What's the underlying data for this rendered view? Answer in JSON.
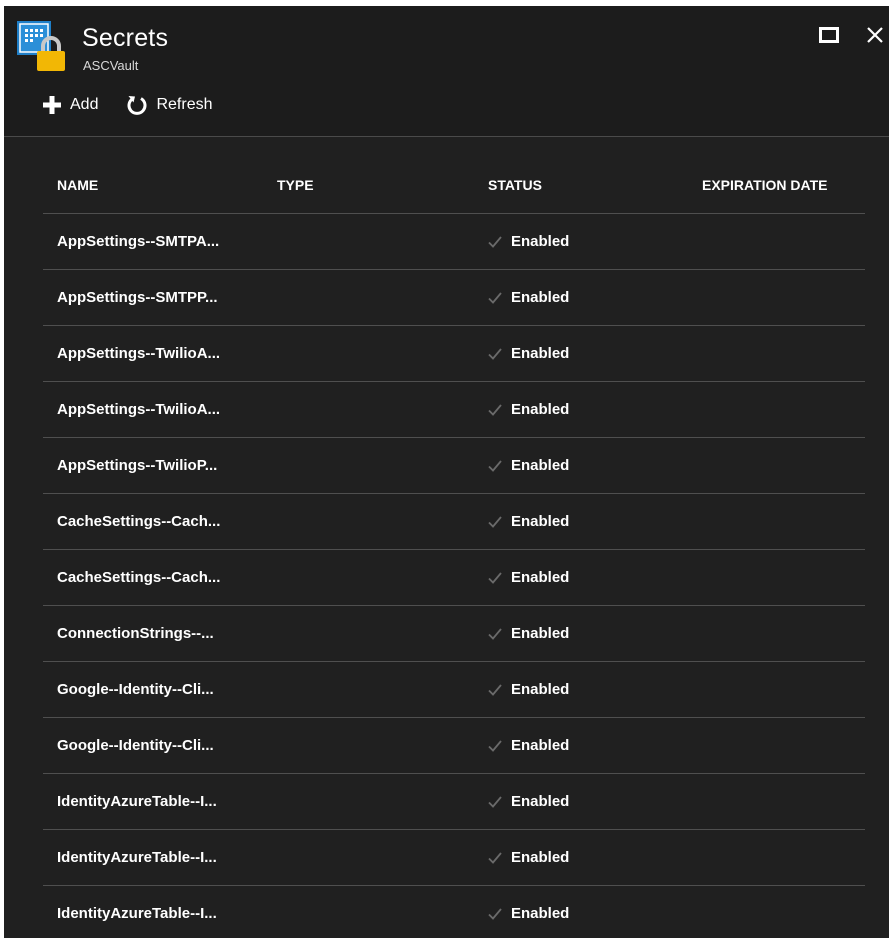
{
  "header": {
    "title": "Secrets",
    "subtitle": "ASCVault",
    "icons": {
      "vault": "key-vault-icon",
      "maximize": "maximize-icon",
      "close": "close-icon"
    }
  },
  "toolbar": {
    "add_label": "Add",
    "refresh_label": "Refresh"
  },
  "table": {
    "columns": [
      "NAME",
      "TYPE",
      "STATUS",
      "EXPIRATION DATE"
    ],
    "rows": [
      {
        "name": "AppSettings--SMTPA...",
        "type": "",
        "status": "Enabled",
        "expiration": ""
      },
      {
        "name": "AppSettings--SMTPP...",
        "type": "",
        "status": "Enabled",
        "expiration": ""
      },
      {
        "name": "AppSettings--TwilioA...",
        "type": "",
        "status": "Enabled",
        "expiration": ""
      },
      {
        "name": "AppSettings--TwilioA...",
        "type": "",
        "status": "Enabled",
        "expiration": ""
      },
      {
        "name": "AppSettings--TwilioP...",
        "type": "",
        "status": "Enabled",
        "expiration": ""
      },
      {
        "name": "CacheSettings--Cach...",
        "type": "",
        "status": "Enabled",
        "expiration": ""
      },
      {
        "name": "CacheSettings--Cach...",
        "type": "",
        "status": "Enabled",
        "expiration": ""
      },
      {
        "name": "ConnectionStrings--...",
        "type": "",
        "status": "Enabled",
        "expiration": ""
      },
      {
        "name": "Google--Identity--Cli...",
        "type": "",
        "status": "Enabled",
        "expiration": ""
      },
      {
        "name": "Google--Identity--Cli...",
        "type": "",
        "status": "Enabled",
        "expiration": ""
      },
      {
        "name": "IdentityAzureTable--I...",
        "type": "",
        "status": "Enabled",
        "expiration": ""
      },
      {
        "name": "IdentityAzureTable--I...",
        "type": "",
        "status": "Enabled",
        "expiration": ""
      },
      {
        "name": "IdentityAzureTable--I...",
        "type": "",
        "status": "Enabled",
        "expiration": ""
      }
    ]
  },
  "colors": {
    "background": "#202020",
    "text": "#ffffff",
    "divider": "#4f4f4f",
    "vault_blue": "#1f7fc8",
    "lock_yellow": "#f2b705",
    "check_gray": "#6a6a6a"
  }
}
